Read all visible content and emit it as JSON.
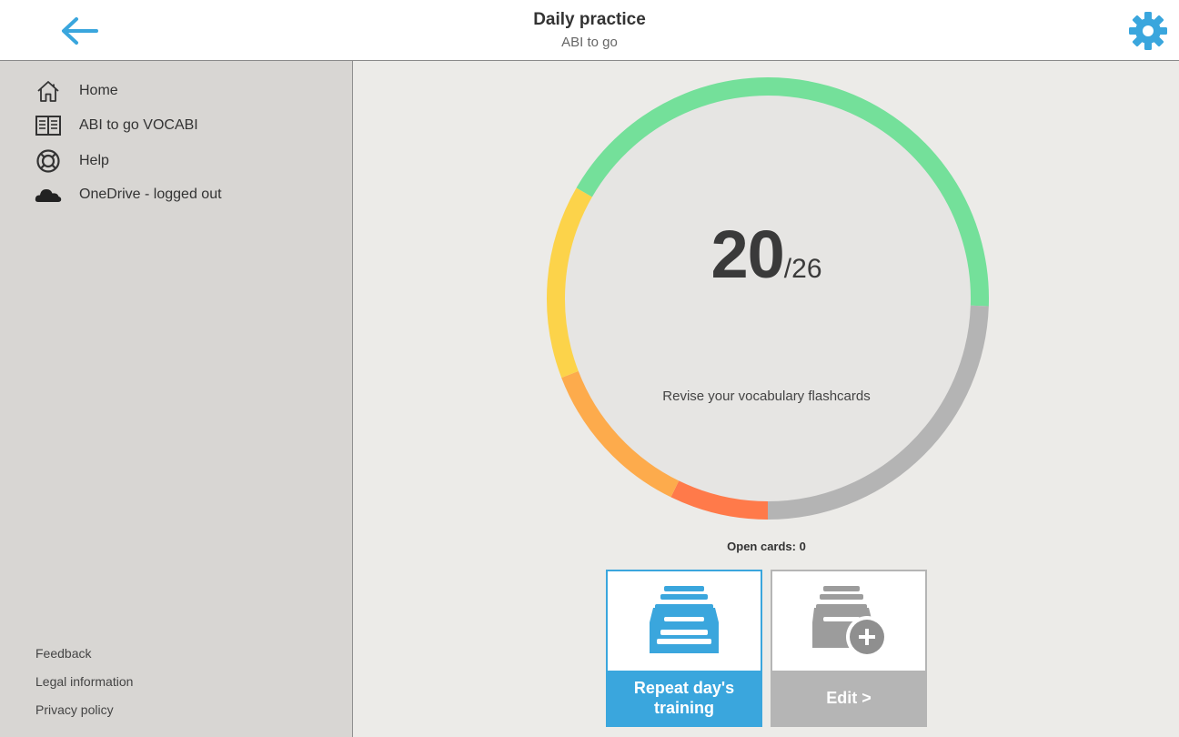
{
  "header": {
    "title": "Daily practice",
    "subtitle": "ABI to go",
    "back_icon": "arrow-left-icon",
    "settings_icon": "gear-icon",
    "accent_color": "#3aa6dd"
  },
  "sidebar": {
    "items": [
      {
        "label": "Home",
        "icon": "home-icon"
      },
      {
        "label": "ABI to go VOCABI",
        "icon": "book-icon"
      },
      {
        "label": "Help",
        "icon": "lifebuoy-icon"
      },
      {
        "label": "OneDrive - logged out",
        "icon": "cloud-icon"
      }
    ],
    "footer_links": [
      "Feedback",
      "Legal information",
      "Privacy policy"
    ]
  },
  "progress": {
    "count": "20",
    "slash": "/",
    "total": "26",
    "description": "Revise your vocabulary flashcards",
    "open_cards": "Open cards: 0",
    "segment_colors": {
      "green": "#74e09a",
      "yellow": "#fcd34a",
      "orange": "#fdab4c",
      "red": "#ff7a4a",
      "gray": "#b4b4b4"
    }
  },
  "tiles": {
    "repeat": {
      "label": "Repeat day's training",
      "icon": "card-box-icon"
    },
    "edit": {
      "label": "Edit >",
      "icon": "card-box-add-icon"
    }
  }
}
